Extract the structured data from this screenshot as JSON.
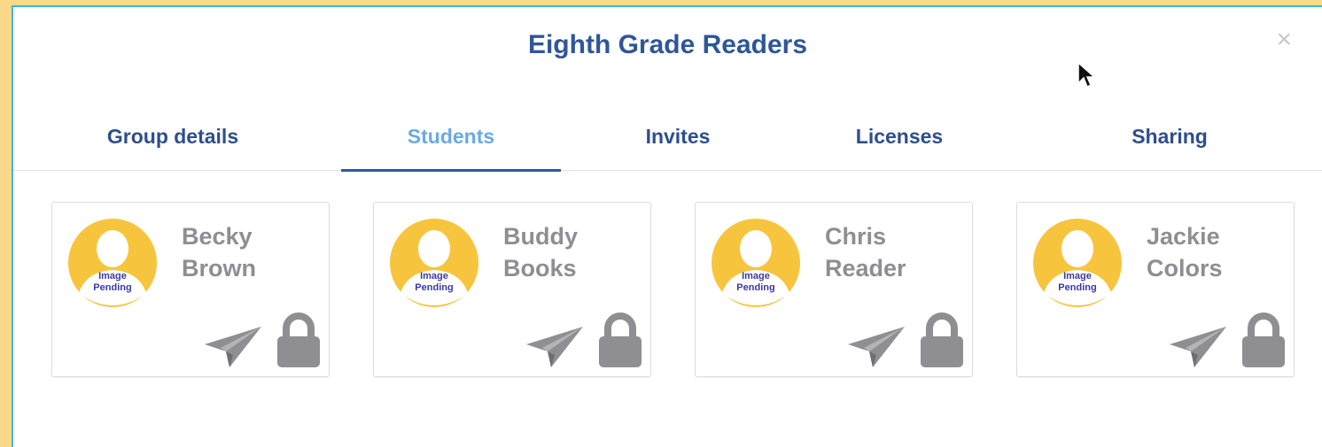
{
  "dialog": {
    "title": "Eighth Grade Readers",
    "close_label": "×"
  },
  "tabs": [
    {
      "label": "Group details",
      "active": false
    },
    {
      "label": "Students",
      "active": true
    },
    {
      "label": "Invites",
      "active": false
    },
    {
      "label": "Licenses",
      "active": false
    },
    {
      "label": "Sharing",
      "active": false
    }
  ],
  "students": [
    {
      "first": "Becky",
      "last": "Brown",
      "avatar_text_1": "Image",
      "avatar_text_2": "Pending"
    },
    {
      "first": "Buddy",
      "last": "Books",
      "avatar_text_1": "Image",
      "avatar_text_2": "Pending"
    },
    {
      "first": "Chris",
      "last": "Reader",
      "avatar_text_1": "Image",
      "avatar_text_2": "Pending"
    },
    {
      "first": "Jackie",
      "last": "Colors",
      "avatar_text_1": "Image",
      "avatar_text_2": "Pending"
    }
  ],
  "icons": {
    "send": "paper-plane-icon",
    "lock": "lock-icon",
    "avatar": "user-silhouette-icon"
  },
  "colors": {
    "background": "#FBD98A",
    "frame": "#3FB6D9",
    "title": "#2F5699",
    "tab": "#2D4F8C",
    "tab_active": "#6AAAE3",
    "avatar": "#F7C53D",
    "student_name": "#8E8E93",
    "icon_gray": "#8E8E93"
  }
}
